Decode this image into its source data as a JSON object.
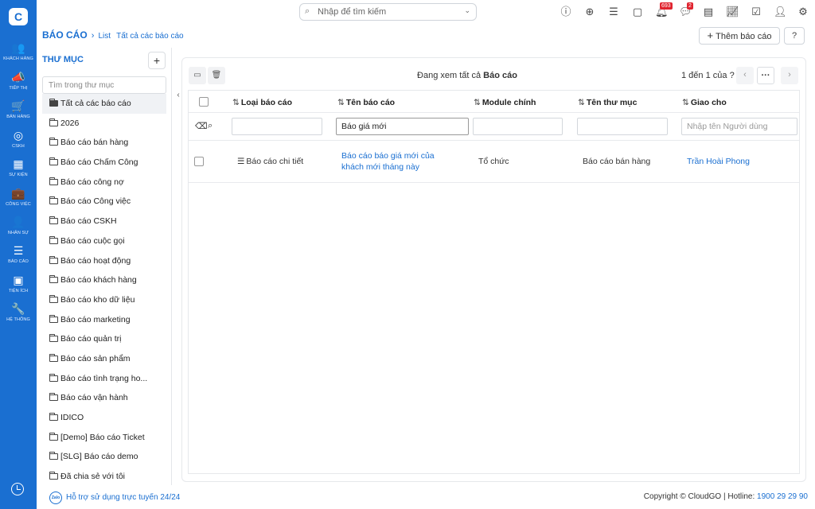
{
  "nav": {
    "logo": "C",
    "items": [
      {
        "icon": "customers-icon",
        "glyph": "👥",
        "label": "KHÁCH HÀNG"
      },
      {
        "icon": "marketing-icon",
        "glyph": "📣",
        "label": "TIẾP THỊ"
      },
      {
        "icon": "cart-icon",
        "glyph": "🛒",
        "label": "BÁN HÀNG"
      },
      {
        "icon": "support-icon",
        "glyph": "◎",
        "label": "CSKH"
      },
      {
        "icon": "calendar-icon",
        "glyph": "▦",
        "label": "SỰ KIỆN"
      },
      {
        "icon": "briefcase-icon",
        "glyph": "💼",
        "label": "CÔNG VIỆC"
      },
      {
        "icon": "person-icon",
        "glyph": "👤",
        "label": "NHÂN SỰ"
      },
      {
        "icon": "report-icon",
        "glyph": "☰",
        "label": "BÁO CÁO"
      },
      {
        "icon": "utilities-icon",
        "glyph": "▣",
        "label": "TIỆN ÍCH"
      },
      {
        "icon": "wrench-icon",
        "glyph": "🔧",
        "label": "HỆ THỐNG"
      }
    ]
  },
  "topbar": {
    "search_placeholder": "Nhập để tìm kiếm",
    "notifications_badge": "693",
    "chat_badge": "2"
  },
  "breadcrumb": {
    "title": "BÁO CÁO",
    "view": "List",
    "current": "Tất cả các báo cáo"
  },
  "actions": {
    "add_report": "Thêm báo cáo"
  },
  "folders": {
    "header": "THƯ MỤC",
    "search_placeholder": "Tìm trong thư mục",
    "items": [
      "Tất cả các báo cáo",
      "2026",
      "Báo cáo bán hàng",
      "Báo cáo Chấm Công",
      "Báo cáo công nợ",
      "Báo cáo Công việc",
      "Báo cáo CSKH",
      "Báo cáo cuộc gọi",
      "Báo cáo hoạt động",
      "Báo cáo khách hàng",
      "Báo cáo kho dữ liệu",
      "Báo cáo marketing",
      "Báo cáo quản trị",
      "Báo cáo sản phẩm",
      "Báo cáo tình trạng ho...",
      "Báo cáo vận hành",
      "IDICO",
      "[Demo] Báo cáo Ticket",
      "[SLG] Báo cáo demo",
      "Đã chia sẻ với tôi"
    ]
  },
  "table": {
    "viewing_prefix": "Đang xem tất cả",
    "viewing_bold": "Báo cáo",
    "pager_text": "1 đến 1 của",
    "pager_help": "?",
    "columns": [
      "Loại báo cáo",
      "Tên báo cáo",
      "Module chính",
      "Tên thư mục",
      "Giao cho"
    ],
    "filters": {
      "name_value": "Báo giá mới",
      "assignee_placeholder": "Nhập tên Người dùng"
    },
    "rows": [
      {
        "type": "Báo cáo chi tiết",
        "name": "Báo cáo báo giá mới của khách mới tháng này",
        "module": "Tổ chức",
        "folder": "Báo cáo bán hàng",
        "assignee": "Trần Hoài Phong"
      }
    ]
  },
  "footer": {
    "support": "Hỗ trợ sử dụng trực tuyến 24/24",
    "zalo": "Zalo",
    "copyright": "Copyright © CloudGO",
    "hotline_label": "Hotline:",
    "hotline": "1900 29 29 90"
  }
}
